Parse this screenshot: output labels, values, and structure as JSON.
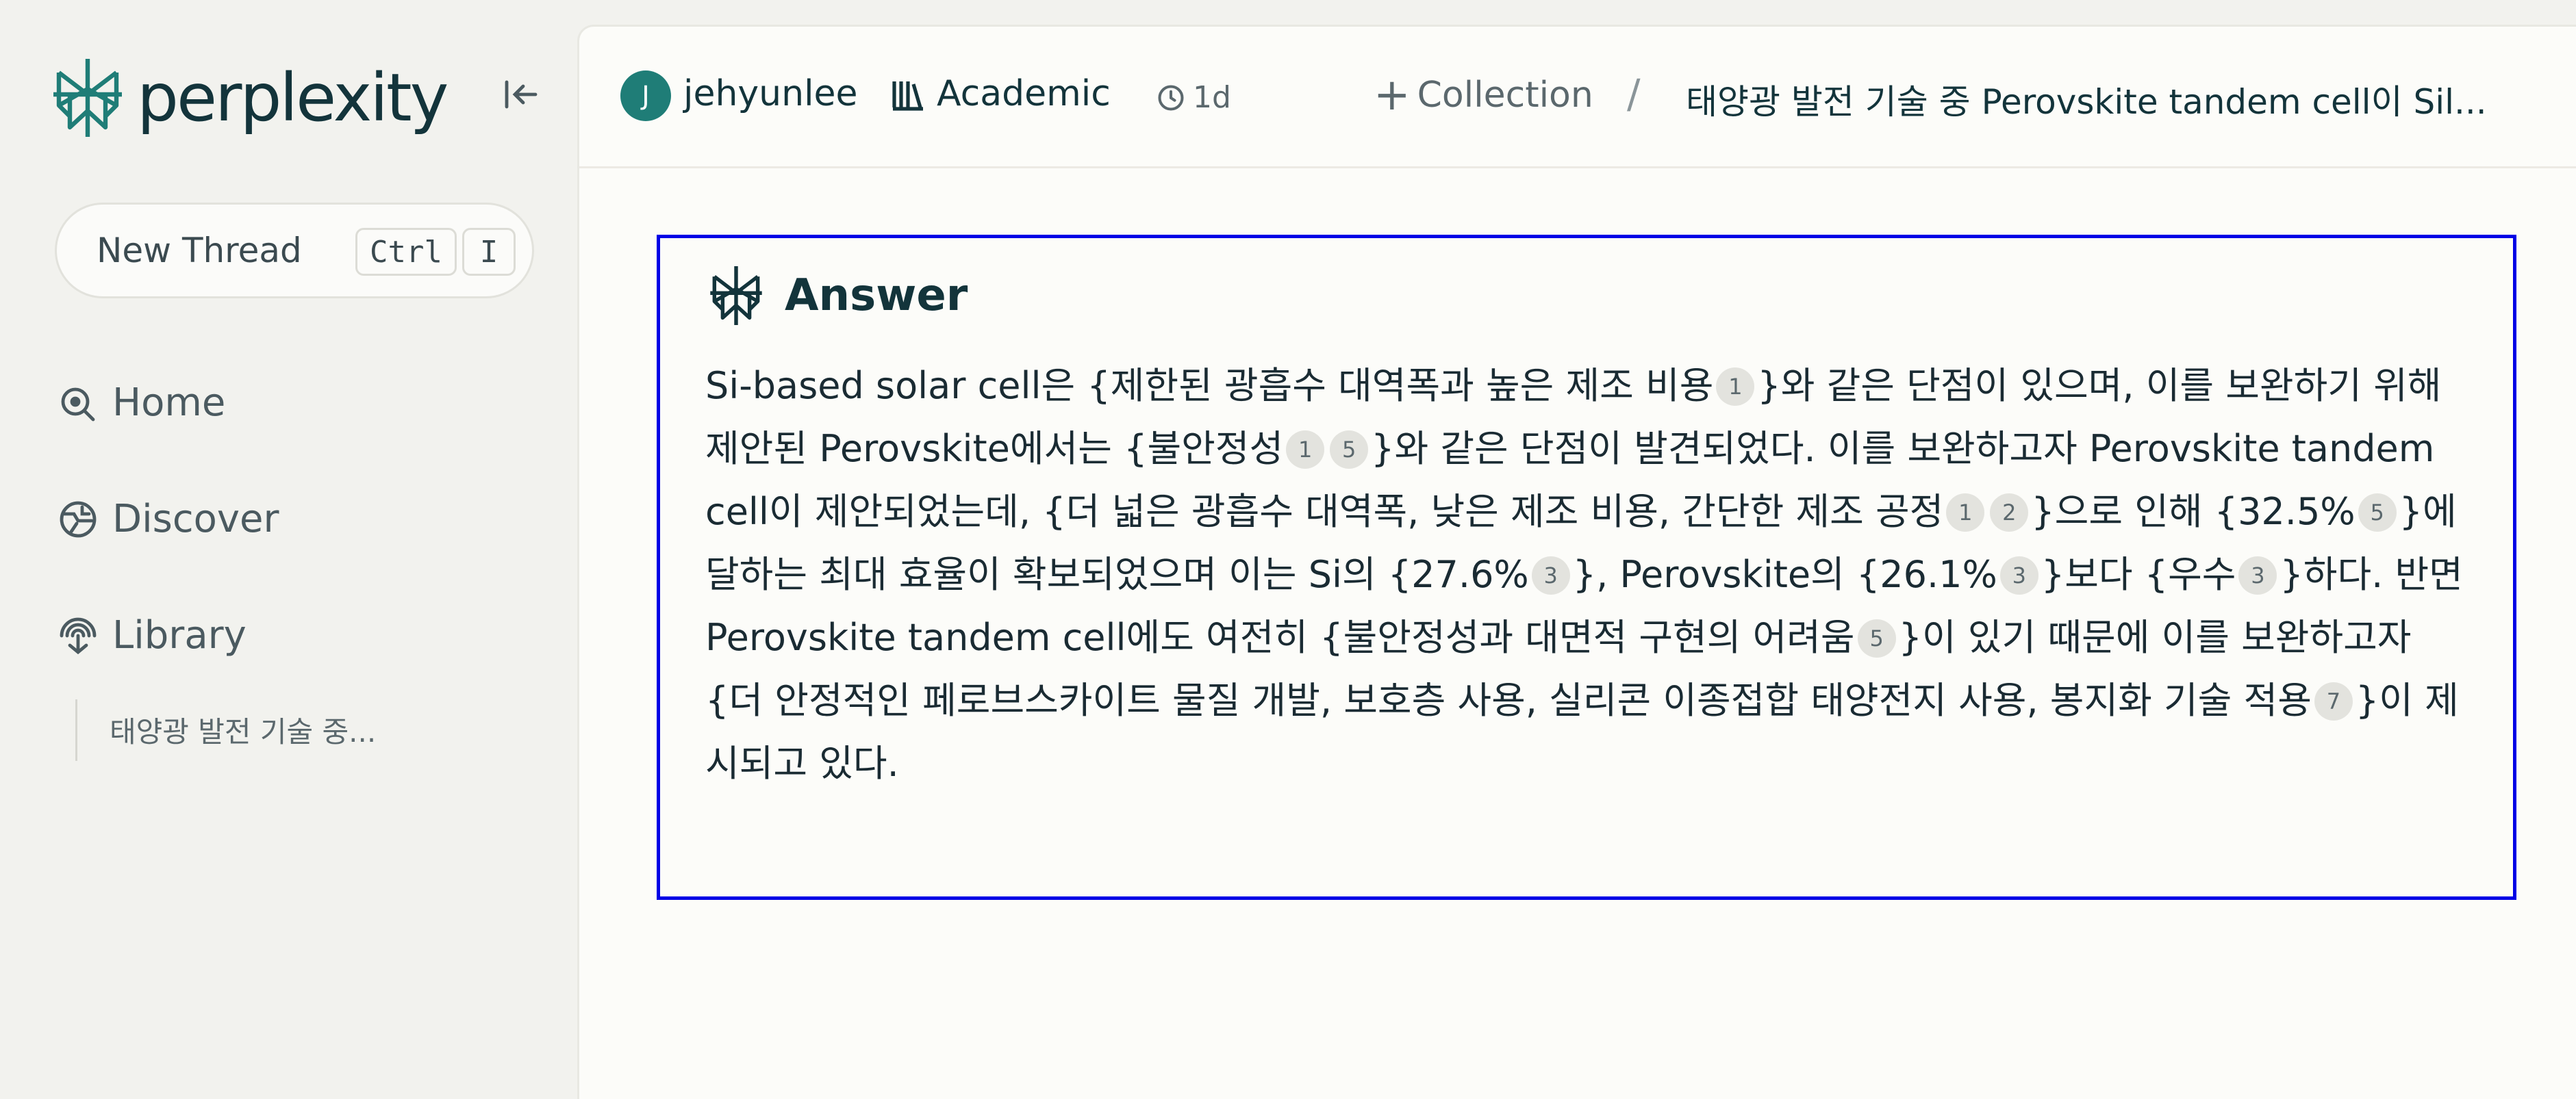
{
  "app": {
    "brand": "perplexity",
    "accent_color": "#1f7d77",
    "highlight_color": "#0000e6"
  },
  "sidebar": {
    "new_thread": {
      "label": "New Thread",
      "shortcut_ctrl": "Ctrl",
      "shortcut_key": "I"
    },
    "items": [
      {
        "label": "Home",
        "icon": "home-icon"
      },
      {
        "label": "Discover",
        "icon": "discover-icon"
      },
      {
        "label": "Library",
        "icon": "library-icon"
      }
    ],
    "library_threads": [
      "태양광 발전 기술 중..."
    ]
  },
  "header": {
    "avatar_initial": "J",
    "username": "jehyunlee",
    "focus": "Academic",
    "age": "1d",
    "collection_label": "Collection",
    "separator": "/",
    "thread_title": "태양광 발전 기술 중 Perovskite tandem cell이 Sil..."
  },
  "answer": {
    "heading": "Answer",
    "segments": [
      {
        "t": "Si-based solar cell은 {제한된 광흡수 대역폭과 높은 제조 비용"
      },
      {
        "c": "1"
      },
      {
        "t": "}와 같은 단점이 있으며, 이를 보완하기 위해 제안된 Perovskite에서는 {불안정성"
      },
      {
        "c": "1"
      },
      {
        "c": "5"
      },
      {
        "t": "}와 같은 단점이 발견되었다. 이를 보완하고자 Perovskite tandem cell이 제안되었는데, {더 넓은 광흡수 대역폭, 낮은 제조 비용, 간단한 제조 공정"
      },
      {
        "c": "1"
      },
      {
        "c": "2"
      },
      {
        "t": "}으로 인해 {32.5%"
      },
      {
        "c": "5"
      },
      {
        "t": "}에 달하는 최대 효율이 확보되었으며 이는 Si의 {27.6%"
      },
      {
        "c": "3"
      },
      {
        "t": "}, Perovskite의 {26.1%"
      },
      {
        "c": "3"
      },
      {
        "t": "}보다 {우수"
      },
      {
        "c": "3"
      },
      {
        "t": "}하다. 반면 Perovskite tandem cell에도 여전히 {불안정성과 대면적 구현의 어려움"
      },
      {
        "c": "5"
      },
      {
        "t": "}이 있기 때문에 이를 보완하고자 {더 안정적인 페로브스카이트 물질 개발, 보호층 사용, 실리콘 이종접합 태양전지 사용, 봉지화 기술 적용"
      },
      {
        "c": "7"
      },
      {
        "t": "}이 제시되고 있다."
      }
    ]
  }
}
